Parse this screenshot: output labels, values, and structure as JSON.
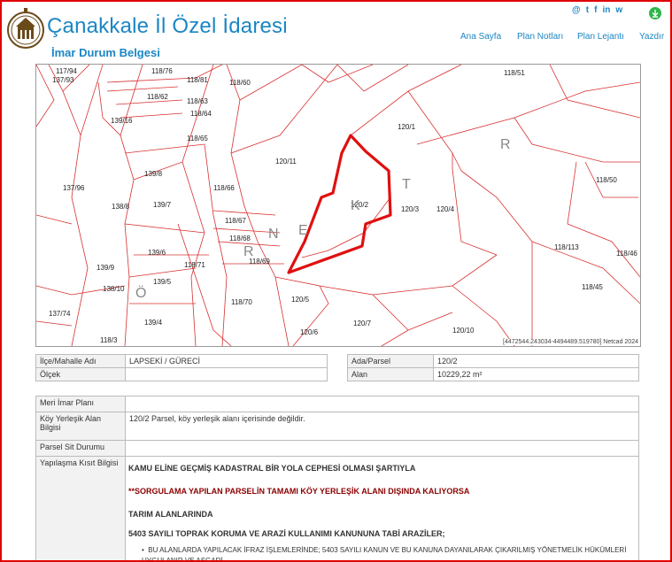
{
  "header": {
    "title": "Çanakkale İl Özel İdaresi",
    "subtitle": "İmar Durum Belgesi",
    "nav": [
      "Ana Sayfa",
      "Plan Notları",
      "Plan Lejantı",
      "Yazdır"
    ],
    "social": [
      "@",
      "t",
      "f",
      "in",
      "w"
    ]
  },
  "map": {
    "coords": "[4472544.243034-4494489.519780] Netcad 2024",
    "parcels": [
      "117/94",
      "137/93",
      "118/76",
      "118/81",
      "118/60",
      "118/51",
      "118/62",
      "118/63",
      "118/64",
      "139/16",
      "118/65",
      "120/1",
      "120/11",
      "139/8",
      "118/66",
      "137/96",
      "138/8",
      "139/7",
      "120/2",
      "120/3",
      "120/4",
      "118/50",
      "118/67",
      "118/68",
      "118/69",
      "139/6",
      "139/9",
      "118/71",
      "139/5",
      "138/10",
      "118/113",
      "118/46",
      "118/45",
      "118/70",
      "120/5",
      "137/74",
      "139/4",
      "120/7",
      "120/6",
      "120/10",
      "118/3"
    ],
    "area_letters": [
      "Ö",
      "R",
      "N",
      "E",
      "K",
      "T",
      "R"
    ]
  },
  "info": {
    "ilce_label": "İlçe/Mahalle Adı",
    "ilce_value": "LAPSEKİ / GÜRECİ",
    "olcek_label": "Ölçek",
    "olcek_value": "",
    "ada_label": "Ada/Parsel",
    "ada_value": "120/2",
    "alan_label": "Alan",
    "alan_value": "10229,22 m²"
  },
  "details": {
    "meri_label": "Meri İmar Planı",
    "meri_value": "",
    "koy_label": "Köy Yerleşik Alan Bilgisi",
    "koy_value": "120/2 Parsel, köy yerleşik alanı içerisinde değildir.",
    "sit_label": "Parsel Sit Durumu",
    "sit_value": "",
    "kisit_label": "Yapılaşma Kısıt Bilgisi",
    "line1": "KAMU ELİNE GEÇMİŞ KADASTRAL BİR YOLA CEPHESİ OLMASI ŞARTIYLA",
    "line2": "**SORGULAMA YAPILAN PARSELİN TAMAMI KÖY YERLEŞİK ALANI DIŞINDA KALIYORSA",
    "line3": "TARIM ALANLARINDA",
    "line4": "5403 SAYILI TOPRAK KORUMA VE ARAZİ KULLANIMI KANUNUNA TABİ ARAZİLER;",
    "bullet": "BU ALANLARDA YAPILACAK İFRAZ İŞLEMLERİNDE; 5403 SAYILI KANUN VE BU KANUNA DAYANILARAK ÇIKARILMIŞ YÖNETMELİK HÜKÜMLERİ UYGULANIR VE ASGARİ"
  }
}
